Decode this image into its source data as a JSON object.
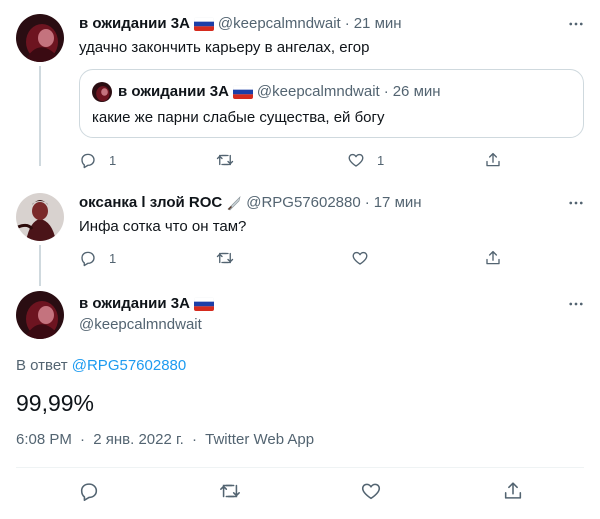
{
  "tweet1": {
    "name": "в ожидании 3А",
    "handle": "@keepcalmndwait",
    "dot": "·",
    "time": "21 мин",
    "text": "удачно закончить карьеру в ангелах, егор",
    "quote": {
      "name": "в ожидании 3А",
      "handle": "@keepcalmndwait",
      "dot": "·",
      "time": "26 мин",
      "text": "какие же парни слабые существа, ей богу"
    },
    "reply_count": "1",
    "retweet_count": "",
    "like_count": "1"
  },
  "tweet2": {
    "name": "оксанка l злой ROC",
    "handle": "@RPG57602880",
    "dot": "·",
    "time": "17 мин",
    "text": "Инфа сотка что он там?",
    "reply_count": "1",
    "retweet_count": "",
    "like_count": ""
  },
  "main_tweet": {
    "name": "в ожидании 3А",
    "handle": "@keepcalmndwait",
    "reply_to_prefix": "В ответ",
    "reply_to_handle": "@RPG57602880",
    "text": "99,99%",
    "time": "6:08 PM",
    "sep": "·",
    "date": "2 янв. 2022 г.",
    "source": "Twitter Web App"
  },
  "colors": {
    "text": "#0f1419",
    "secondary": "#536471",
    "link": "#1d9bf0",
    "border": "#cfd9de"
  },
  "icons": {
    "reply": "reply-icon",
    "retweet": "retweet-icon",
    "like": "heart-icon",
    "share": "share-icon",
    "more": "more-icon",
    "flag": "russia-flag-icon",
    "knife": "knife-emoji-icon"
  }
}
